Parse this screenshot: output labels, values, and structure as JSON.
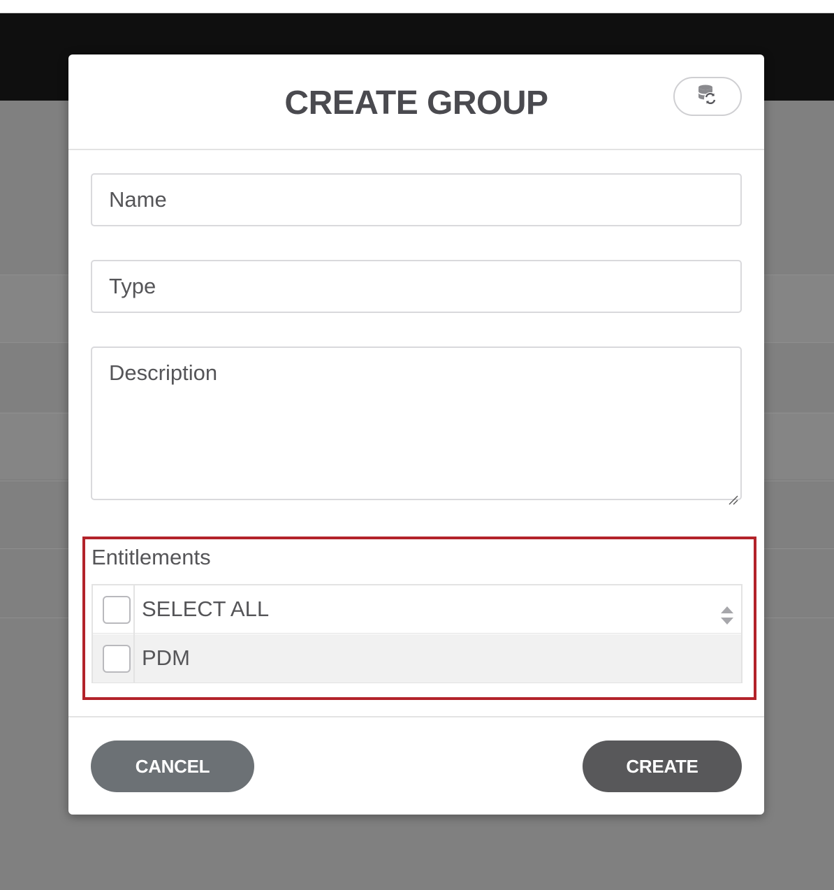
{
  "modal": {
    "title": "CREATE GROUP",
    "sync_icon": "database-sync-icon"
  },
  "form": {
    "name_placeholder": "Name",
    "type_placeholder": "Type",
    "description_placeholder": "Description"
  },
  "entitlements": {
    "label": "Entitlements",
    "rows": [
      {
        "label": "SELECT ALL",
        "checked": false
      },
      {
        "label": "PDM",
        "checked": false
      }
    ],
    "highlight_color": "#b3232a"
  },
  "footer": {
    "cancel_label": "CANCEL",
    "create_label": "CREATE"
  }
}
